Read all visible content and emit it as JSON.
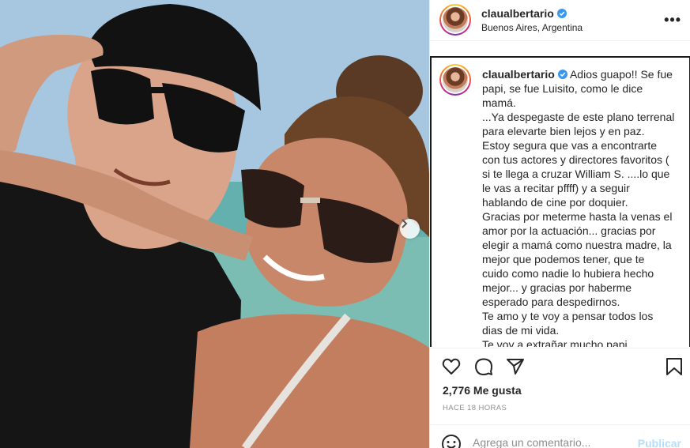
{
  "post": {
    "username": "claualbertario",
    "location": "Buenos Aires, Argentina",
    "caption_lines": [
      "Adios guapo!! Se fue",
      "papi, se fue Luisito, como le dice",
      "mamá.",
      "...Ya despegaste de este plano terrenal",
      "para elevarte bien lejos y en paz.",
      "Estoy segura que vas a encontrarte",
      "con tus actores y directores favoritos (",
      "si te llega a cruzar William S. ....lo que",
      "le vas a recitar pffff) y a seguir",
      "hablando de cine por doquier.",
      "Gracias por meterme hasta la venas el",
      "amor por la actuación... gracias por",
      "elegir a mamá como nuestra madre, la",
      "mejor que podemos tener, que te",
      "cuido como nadie lo hubiera hecho",
      "mejor... y gracias por haberme",
      "esperado para despedirnos.",
      "Te amo y te voy a pensar todos los",
      "dias de mi vida.",
      "Te voy a extrañar mucho papi"
    ],
    "likes": "2,776 Me gusta",
    "time": "HACE 18 HORAS"
  },
  "comment": {
    "placeholder": "Agrega un comentario...",
    "publish_label": "Publicar"
  },
  "icons": {
    "more": "more-options-icon",
    "verified": "verified-badge-icon",
    "like": "heart-icon",
    "comment": "comment-icon",
    "share": "share-icon",
    "save": "bookmark-icon",
    "emoji": "emoji-icon",
    "next": "chevron-right-icon"
  },
  "colors": {
    "verified_blue": "#3897f0",
    "publish_disabled": "#b2dffc",
    "muted_text": "#8e8e8e"
  }
}
